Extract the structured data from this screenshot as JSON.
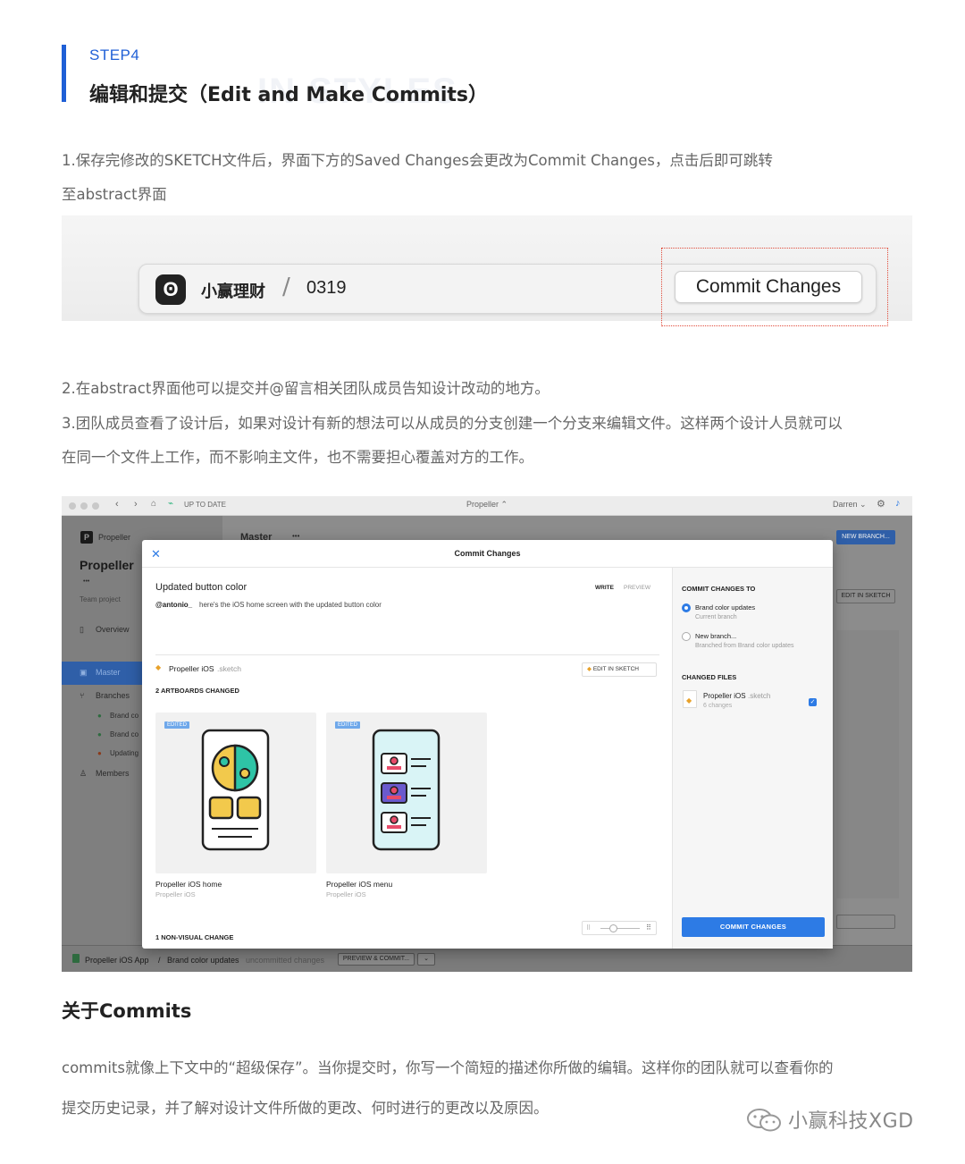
{
  "step": {
    "label": "STEP4",
    "title": "编辑和提交（Edit and Make Commits）",
    "ghost": "IN STYLES"
  },
  "paragraphs": {
    "p1_line1": "1.保存完修改的SKETCH文件后，界面下方的Saved Changes会更改为Commit Changes，点击后即可跳转",
    "p1_line2": "至abstract界面",
    "p2": "2.在abstract界面他可以提交并@留言相关团队成员告知设计改动的地方。",
    "p3_line1": "3.团队成员查看了设计后，如果对设计有新的想法可以从成员的分支创建一个分支来编辑文件。这样两个设计人员就可以",
    "p3_line2": "在同一个文件上工作，而不影响主文件，也不需要担心覆盖对方的工作。"
  },
  "abstract_bar": {
    "logo": "ʘ",
    "project": "小赢理财",
    "slash": "/",
    "branch": "0319",
    "commit_button": "Commit Changes"
  },
  "app": {
    "titlebar": {
      "status": "UP TO DATE",
      "project": "Propeller ⌃",
      "user": "Darren ⌄"
    },
    "sidebar": {
      "app_name": "Propeller",
      "project_title": "Propeller",
      "more": "•••",
      "team_project": "Team project",
      "items": [
        "Overview",
        "Master",
        "Branches",
        "Brand co",
        "Brand co",
        "Updating",
        "Members"
      ]
    },
    "main": {
      "branch_title": "Master",
      "more": "•••",
      "new_branch": "NEW BRANCH...",
      "edit_in_sketch": "EDIT IN SKETCH"
    },
    "footer": {
      "file": "Propeller iOS App",
      "slash": "/",
      "branch": "Brand color updates",
      "status": "uncommitted changes",
      "preview_commit": "PREVIEW & COMMIT...",
      "dropdown": "⌄"
    },
    "modal": {
      "close": "✕",
      "title": "Commit Changes",
      "summary": "Updated button color",
      "write_tab": "WRITE",
      "preview_tab": "PREVIEW",
      "mention": "@antonio_",
      "description": "here's the iOS home screen with the updated button color",
      "file_name": "Propeller iOS",
      "file_ext": ".sketch",
      "edit_in_sketch": "EDIT IN SKETCH",
      "artboards_changed": "2 ARTBOARDS CHANGED",
      "artboards": [
        {
          "badge": "EDITED",
          "name": "Propeller iOS home",
          "page": "Propeller iOS"
        },
        {
          "badge": "EDITED",
          "name": "Propeller iOS menu",
          "page": "Propeller iOS"
        }
      ],
      "non_visual": "1 NON-VISUAL CHANGE",
      "right": {
        "commit_to": "COMMIT CHANGES TO",
        "opt1_title": "Brand color updates",
        "opt1_sub": "Current branch",
        "opt2_title": "New branch...",
        "opt2_sub": "Branched from Brand color updates",
        "changed_files": "CHANGED FILES",
        "file_name": "Propeller iOS",
        "file_ext": ".sketch",
        "file_changes": "6 changes",
        "commit_button": "COMMIT CHANGES"
      }
    }
  },
  "about": {
    "heading": "关于Commits",
    "line1": "commits就像上下文中的“超级保存”。当你提交时，你写一个简短的描述你所做的编辑。这样你的团队就可以查看你的",
    "line2": "提交历史记录，并了解对设计文件所做的更改、何时进行的更改以及原因。"
  },
  "watermark": "小赢科技XGD",
  "colors": {
    "accent": "#1f5fd6",
    "highlight_border": "#e04b3a",
    "app_primary": "#2d7be5"
  }
}
